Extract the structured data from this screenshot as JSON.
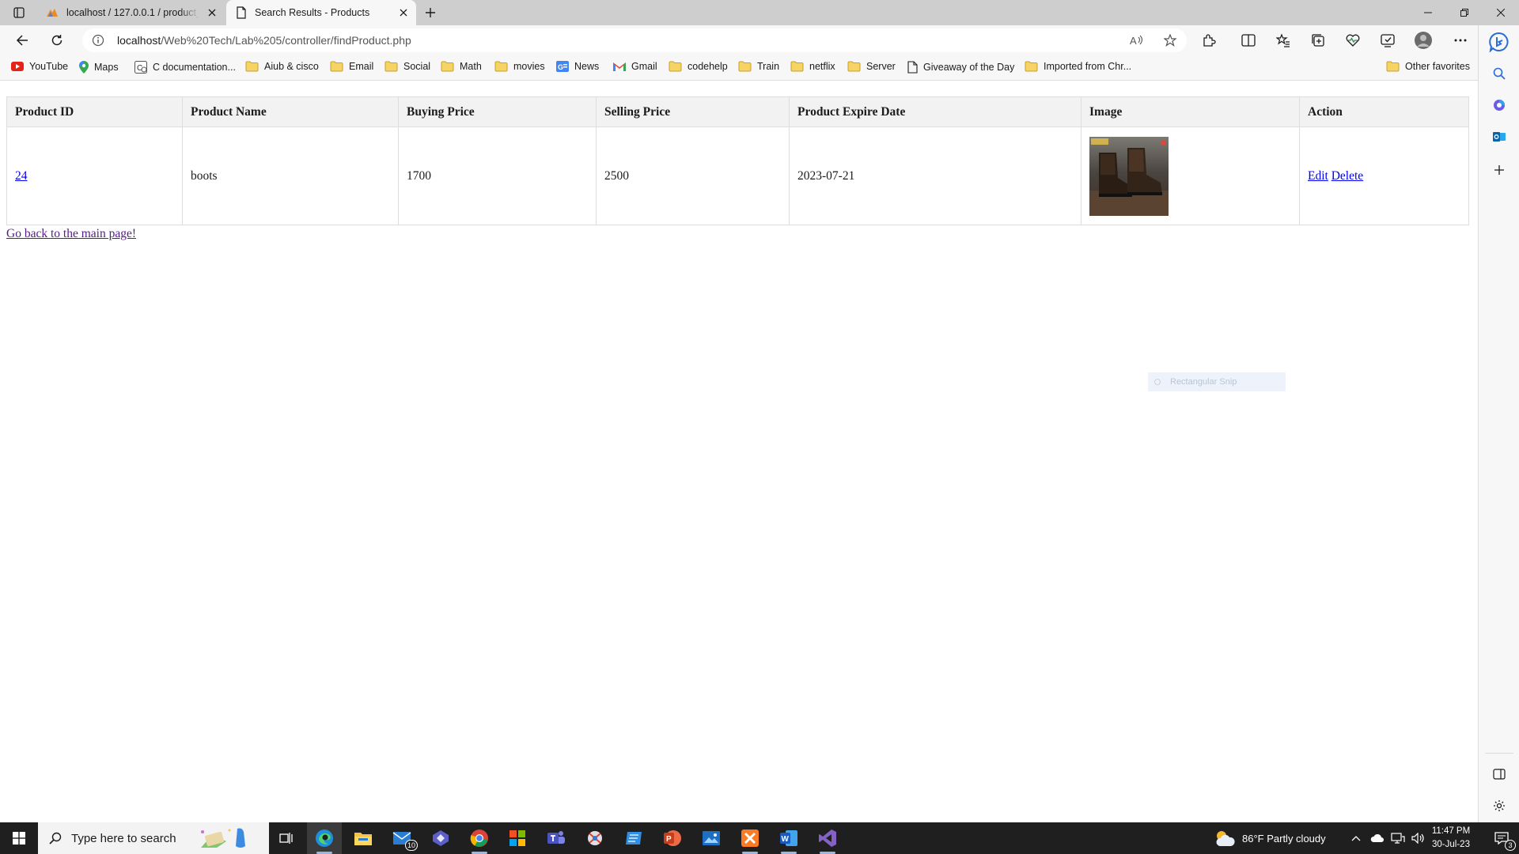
{
  "browser": {
    "tabs": [
      {
        "title": "localhost / 127.0.0.1 / product_db"
      },
      {
        "title": "Search Results - Products"
      }
    ],
    "address": {
      "host": "localhost",
      "path": "/Web%20Tech/Lab%205/controller/findProduct.php"
    },
    "favorites": [
      "YouTube",
      "Maps",
      "C documentation...",
      "Aiub & cisco",
      "Email",
      "Social",
      "Math",
      "movies",
      "News",
      "Gmail",
      "codehelp",
      "Train",
      "netflix",
      "Server",
      "Giveaway of the Day",
      "Imported from Chr...",
      "Other favorites"
    ]
  },
  "page": {
    "columns": [
      "Product ID",
      "Product Name",
      "Buying Price",
      "Selling Price",
      "Product Expire Date",
      "Image",
      "Action"
    ],
    "rows": [
      {
        "id": "24",
        "name": "boots",
        "buying_price": "1700",
        "selling_price": "2500",
        "expire_date": "2023-07-21",
        "image_icon": "boots-image",
        "edit_label": "Edit",
        "delete_label": "Delete"
      }
    ],
    "back_link": "Go back to the main page!",
    "snip_label": "Rectangular Snip"
  },
  "taskbar": {
    "search_placeholder": "Type here to search",
    "mail_badge": "10",
    "weather": "86°F  Partly cloudy",
    "time": "11:47 PM",
    "date": "30-Jul-23",
    "notification_count": "3"
  },
  "colors": {
    "link": "#0000ee",
    "visited_link": "#551a8b",
    "header_bg": "#f2f2f2"
  }
}
